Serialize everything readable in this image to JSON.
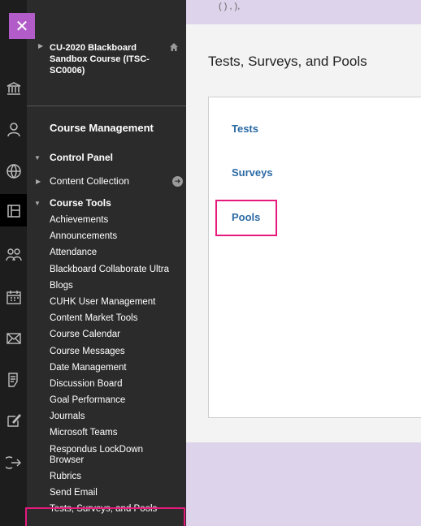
{
  "nav": {
    "close_glyph": "✕",
    "rail_icons": [
      "institution-icon",
      "user-icon",
      "globe-icon",
      "courses-icon",
      "groups-icon",
      "calendar-icon",
      "mail-icon",
      "grades-icon",
      "tools-icon",
      "sign-out-icon"
    ]
  },
  "course": {
    "title": "CU-2020 Blackboard Sandbox Course (ITSC-SC0006)"
  },
  "menu": {
    "section": "Course Management",
    "control_panel": "Control Panel",
    "content_collection": "Content Collection",
    "course_tools": "Course Tools",
    "tools": [
      "Achievements",
      "Announcements",
      "Attendance",
      "Blackboard Collaborate Ultra",
      "Blogs",
      "CUHK User Management",
      "Content Market Tools",
      "Course Calendar",
      "Course Messages",
      "Date Management",
      "Discussion Board",
      "Goal Performance",
      "Journals",
      "Microsoft Teams",
      "Respondus LockDown Browser",
      "Rubrics",
      "Send Email",
      "Tests, Surveys, and Pools"
    ]
  },
  "top": {
    "partial_text": "(                )           ,  ),"
  },
  "main": {
    "page_title": "Tests, Surveys, and Pools",
    "links": [
      "Tests",
      "Surveys",
      "Pools"
    ]
  },
  "colors": {
    "highlight": "#e6197d",
    "link": "#2b6aa4",
    "accent": "#b15cc9"
  }
}
